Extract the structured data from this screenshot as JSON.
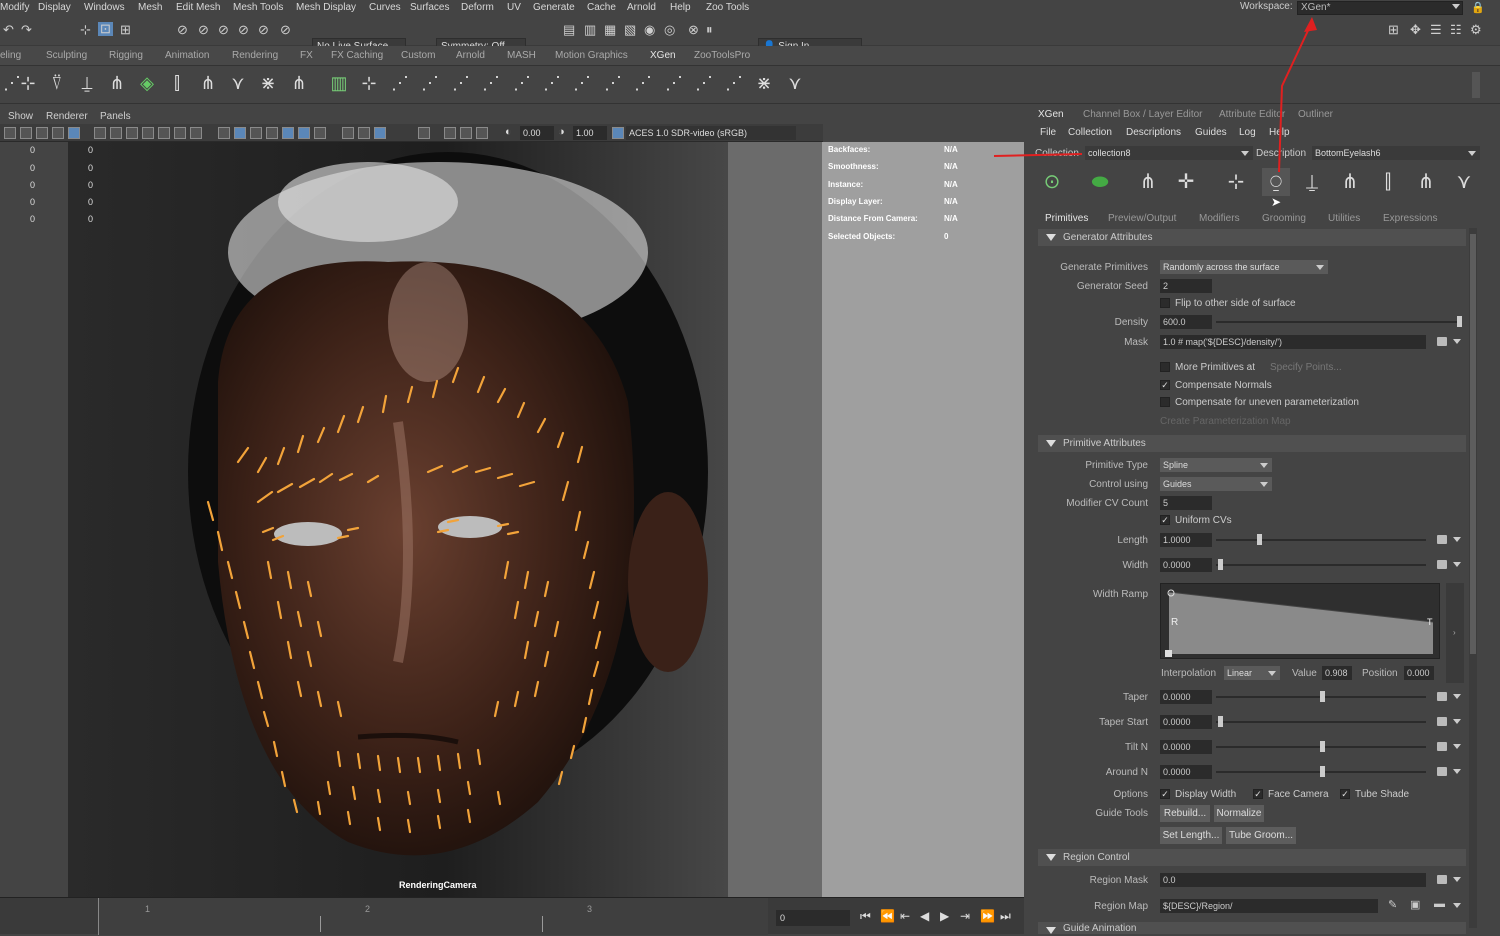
{
  "menubar": {
    "items": [
      "Modify",
      "Display",
      "Windows",
      "Mesh",
      "Edit Mesh",
      "Mesh Tools",
      "Mesh Display",
      "Curves",
      "Surfaces",
      "Deform",
      "UV",
      "Generate",
      "Cache",
      "Arnold",
      "Help",
      "Zoo Tools"
    ],
    "workspace_label": "Workspace:",
    "workspace_value": "XGen*"
  },
  "statusline": {
    "live_surface": "No Live Surface",
    "symmetry": "Symmetry: Off",
    "sign_in": "Sign In"
  },
  "shelf_tabs": {
    "items": [
      "eling",
      "Sculpting",
      "Rigging",
      "Animation",
      "Rendering",
      "FX",
      "FX Caching",
      "Custom",
      "Arnold",
      "MASH",
      "Motion Graphics",
      "XGen",
      "ZooToolsPro"
    ],
    "selected": "XGen"
  },
  "viewport": {
    "menus": [
      "Show",
      "Renderer",
      "Panels"
    ],
    "exposure": "0.00",
    "gamma": "1.00",
    "color_space": "ACES 1.0 SDR-video (sRGB)",
    "camera_label": "RenderingCamera",
    "left_values": [
      "0",
      "0",
      "0",
      "0",
      "0"
    ],
    "right_values": [
      "0",
      "0",
      "0",
      "0",
      "0"
    ]
  },
  "hud": {
    "rows": [
      {
        "k": "Backfaces:",
        "v": "N/A"
      },
      {
        "k": "Smoothness:",
        "v": "N/A"
      },
      {
        "k": "Instance:",
        "v": "N/A"
      },
      {
        "k": "Display Layer:",
        "v": "N/A"
      },
      {
        "k": "Distance From Camera:",
        "v": "N/A"
      },
      {
        "k": "Selected Objects:",
        "v": "0"
      }
    ]
  },
  "timeline": {
    "ticks": [
      "1",
      "2",
      "3"
    ],
    "current_frame": "0"
  },
  "panel": {
    "tabs": [
      "XGen",
      "Channel Box / Layer Editor",
      "Attribute Editor",
      "Outliner"
    ],
    "menus": [
      "File",
      "Collection",
      "Descriptions",
      "Guides",
      "Log",
      "Help"
    ],
    "collection_label": "Collection",
    "collection_value": "collection8",
    "description_label": "Description",
    "description_value": "BottomEyelash6",
    "subtabs": [
      "Primitives",
      "Preview/Output",
      "Modifiers",
      "Grooming",
      "Utilities",
      "Expressions"
    ],
    "gen": {
      "title": "Generator Attributes",
      "generate_label": "Generate Primitives",
      "generate_value": "Randomly across the surface",
      "seed_label": "Generator Seed",
      "seed_value": "2",
      "flip_label": "Flip to other side of surface",
      "density_label": "Density",
      "density_value": "600.0",
      "mask_label": "Mask",
      "mask_value": "1.0 # map('${DESC}/density/')",
      "more_label": "More Primitives at",
      "specify": "Specify Points...",
      "comp_normals": "Compensate Normals",
      "comp_uneven": "Compensate for uneven parameterization",
      "create_map": "Create Parameterization Map"
    },
    "prim": {
      "title": "Primitive Attributes",
      "type_label": "Primitive Type",
      "type_value": "Spline",
      "control_label": "Control using",
      "control_value": "Guides",
      "cv_label": "Modifier CV Count",
      "cv_value": "5",
      "uniform": "Uniform CVs",
      "length_label": "Length",
      "length_value": "1.0000",
      "width_label": "Width",
      "width_value": "0.0000",
      "ramp_label": "Width Ramp",
      "ramp_R": "R",
      "ramp_T": "T",
      "interp_label": "Interpolation",
      "interp_value": "Linear",
      "value_label": "Value",
      "value_value": "0.908",
      "position_label": "Position",
      "position_value": "0.000",
      "taper_label": "Taper",
      "taper_value": "0.0000",
      "taperstart_label": "Taper Start",
      "taperstart_value": "0.0000",
      "tilt_label": "Tilt N",
      "tilt_value": "0.0000",
      "around_label": "Around N",
      "around_value": "0.0000",
      "options_label": "Options",
      "display_width": "Display Width",
      "face_camera": "Face Camera",
      "tube_shade": "Tube Shade",
      "guide_tools_label": "Guide Tools",
      "rebuild": "Rebuild...",
      "normalize": "Normalize",
      "set_length": "Set Length...",
      "tube_groom": "Tube Groom..."
    },
    "region": {
      "title": "Region Control",
      "mask_label": "Region Mask",
      "mask_value": "0.0",
      "map_label": "Region Map",
      "map_value": "${DESC}/Region/"
    },
    "guide_anim": {
      "title": "Guide Animation"
    }
  }
}
